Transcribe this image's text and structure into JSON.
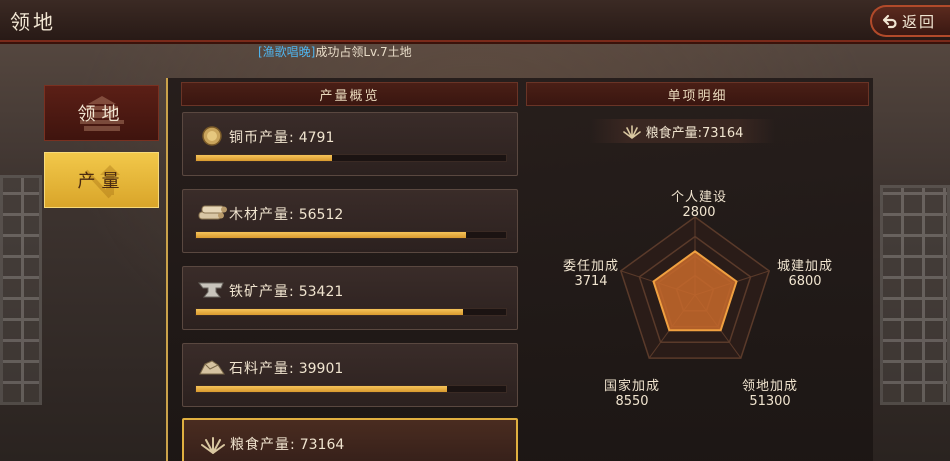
{
  "header": {
    "title": "领地",
    "back_label": "返回"
  },
  "notice": {
    "player": "[渔歌唱晚]",
    "message": "成功占领Lv.7土地"
  },
  "tabs": [
    {
      "label": "领地",
      "active": false
    },
    {
      "label": "产量",
      "active": true
    }
  ],
  "overview": {
    "header": "产量概览",
    "items": [
      {
        "icon": "coin-icon",
        "label": "铜币产量:",
        "value": "4791",
        "progress": 0.44
      },
      {
        "icon": "wood-icon",
        "label": "木材产量:",
        "value": "56512",
        "progress": 0.87
      },
      {
        "icon": "anvil-icon",
        "label": "铁矿产量:",
        "value": "53421",
        "progress": 0.86
      },
      {
        "icon": "stone-icon",
        "label": "石料产量:",
        "value": "39901",
        "progress": 0.81
      },
      {
        "icon": "grain-icon",
        "label": "粮食产量:",
        "value": "73164",
        "progress": 0.9,
        "selected": true
      }
    ]
  },
  "detail": {
    "header": "单项明细",
    "total_label": "粮食产量:73164",
    "bonuses": [
      {
        "name": "个人建设",
        "value": "2800"
      },
      {
        "name": "城建加成",
        "value": "6800"
      },
      {
        "name": "领地加成",
        "value": "51300"
      },
      {
        "name": "国家加成",
        "value": "8550"
      },
      {
        "name": "委任加成",
        "value": "3714"
      }
    ]
  },
  "colors": {
    "accent_gold": "#f2c84a",
    "bar_fill": "#e9ae44",
    "player_name": "#4fb6f0",
    "radar_fill": "#c86a2c",
    "radar_stroke": "#f0a040"
  }
}
